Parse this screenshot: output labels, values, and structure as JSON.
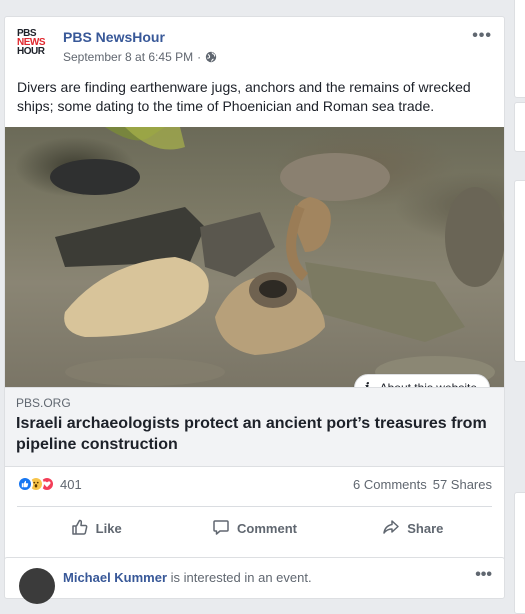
{
  "post": {
    "page_name": "PBS NewsHour",
    "logo_lines": [
      "PBS",
      "NEWS",
      "HOUR"
    ],
    "timestamp": "September 8 at 6:45 PM",
    "separator": "·",
    "privacy_icon": "globe-icon",
    "menu_label": "•••",
    "text": "Divers are finding earthenware jugs, anchors and the remains of wrecked ships; some dating to the time of Phoenician and Roman sea trade.",
    "about_website_label": "About this website",
    "link_domain": "PBS.ORG",
    "link_headline": "Israeli archaeologists protect an ancient port’s treasures from pipeline construction"
  },
  "stats": {
    "reactions": [
      "like-icon",
      "wow-icon",
      "love-icon"
    ],
    "reaction_count": "401",
    "comments": "6 Comments",
    "shares": "57 Shares"
  },
  "actions": {
    "like": "Like",
    "comment": "Comment",
    "share": "Share"
  },
  "next_post": {
    "name": "Michael Kummer",
    "text": "is interested in an event.",
    "menu_label": "•••"
  },
  "colors": {
    "link_blue": "#385898",
    "secondary_text": "#606770",
    "like_blue": "#1877f2",
    "love_red": "#f33e58",
    "wow_yellow": "#f7c44b"
  }
}
